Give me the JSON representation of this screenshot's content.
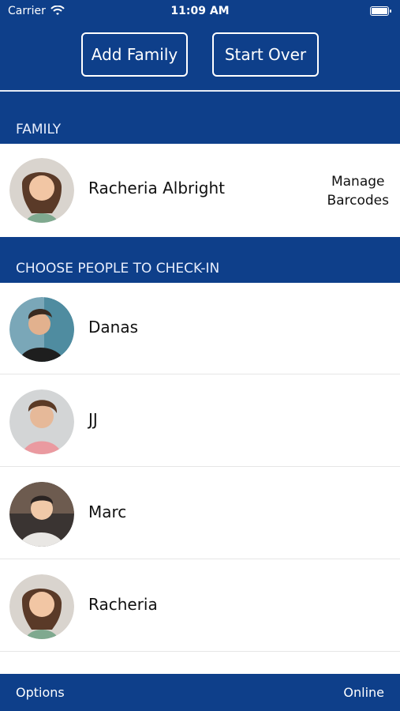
{
  "status": {
    "carrier": "Carrier",
    "time": "11:09 AM"
  },
  "top": {
    "add_family": "Add Family",
    "start_over": "Start Over"
  },
  "sections": {
    "family": "FAMILY",
    "choose": "CHOOSE PEOPLE TO CHECK-IN"
  },
  "family": {
    "name": "Racheria Albright",
    "manage_line1": "Manage",
    "manage_line2": "Barcodes"
  },
  "people": [
    {
      "name": "Danas"
    },
    {
      "name": "JJ"
    },
    {
      "name": "Marc"
    },
    {
      "name": "Racheria"
    }
  ],
  "bottom": {
    "options": "Options",
    "online": "Online"
  },
  "colors": {
    "primary": "#0e3f8a",
    "white": "#ffffff"
  },
  "icons": [
    "wifi-icon",
    "battery-icon",
    "avatar-image"
  ]
}
